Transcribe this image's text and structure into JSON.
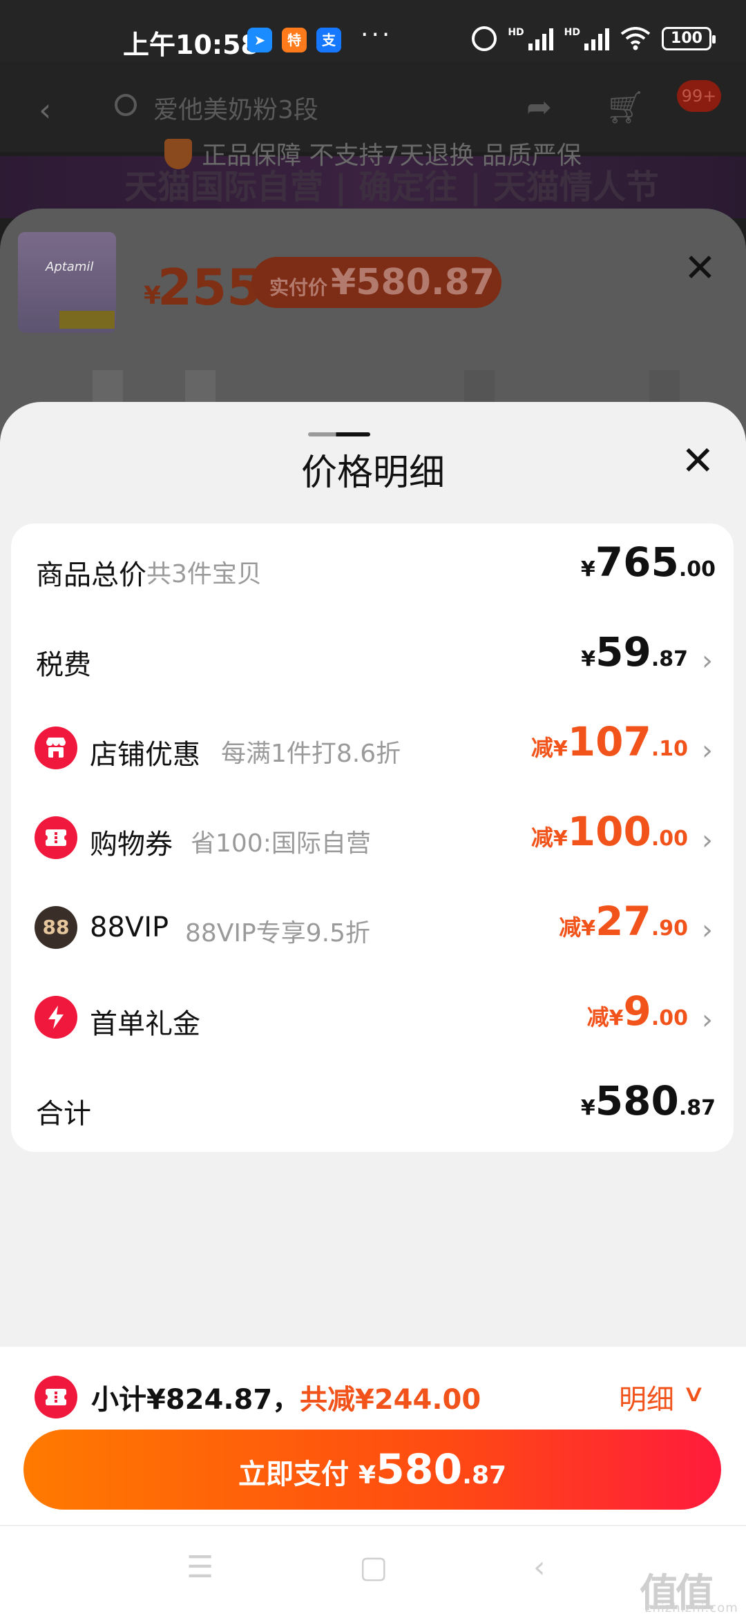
{
  "status_bar": {
    "time": "上午10:58",
    "more": "···",
    "battery": "100",
    "hd": "HD"
  },
  "header": {
    "search_text": "爱他美奶粉3段",
    "cart_badge": "99+"
  },
  "guarantee": "正品保障 不支持7天退换 品质严保",
  "banner": "天猫国际自营 | 确定往 | 天猫情人节",
  "sku_sheet": {
    "thumb_brand": "Aptamil",
    "price_yen": "¥",
    "price": "255",
    "paid_label": "实付价",
    "paid_value": "¥580.87"
  },
  "price_detail": {
    "title": "价格明细",
    "rows": [
      {
        "label": "商品总价",
        "note": "共3件宝贝",
        "prefix": "",
        "yen": "¥",
        "int": "765",
        "dec": ".00",
        "color": "#111111",
        "arrow": false,
        "icon": ""
      },
      {
        "label": "税费",
        "note": "",
        "prefix": "",
        "yen": "¥",
        "int": "59",
        "dec": ".87",
        "color": "#111111",
        "arrow": true,
        "icon": ""
      },
      {
        "label": "店铺优惠",
        "note": "每满1件打8.6折",
        "prefix": "减",
        "yen": "¥",
        "int": "107",
        "dec": ".10",
        "color": "#f1531a",
        "arrow": true,
        "icon": "shop-icon"
      },
      {
        "label": "购物券",
        "note": "省100:国际自营",
        "prefix": "减",
        "yen": "¥",
        "int": "100",
        "dec": ".00",
        "color": "#f1531a",
        "arrow": true,
        "icon": "coupon-icon"
      },
      {
        "label": "88VIP",
        "note": "88VIP专享9.5折",
        "prefix": "减",
        "yen": "¥",
        "int": "27",
        "dec": ".90",
        "color": "#f1531a",
        "arrow": true,
        "icon": "88vip-icon",
        "icon_text": "88"
      },
      {
        "label": "首单礼金",
        "note": "",
        "prefix": "减",
        "yen": "¥",
        "int": "9",
        "dec": ".00",
        "color": "#f1531a",
        "arrow": true,
        "icon": "lightning-icon"
      },
      {
        "label": "合计",
        "note": "",
        "prefix": "",
        "yen": "¥",
        "int": "580",
        "dec": ".87",
        "color": "#111111",
        "arrow": false,
        "icon": ""
      }
    ]
  },
  "summary": {
    "subtotal": "小计¥824.87，",
    "reduce": "共减¥244.00",
    "detail": "明细"
  },
  "pay_button": {
    "label": "立即支付",
    "yen": "¥",
    "int": "580",
    "dec": ".87"
  },
  "watermark": {
    "text": "值值值",
    "sub": "zhizhizhi.com"
  },
  "colors": {
    "accent": "#f1531a",
    "brand_red": "#f0183c"
  }
}
